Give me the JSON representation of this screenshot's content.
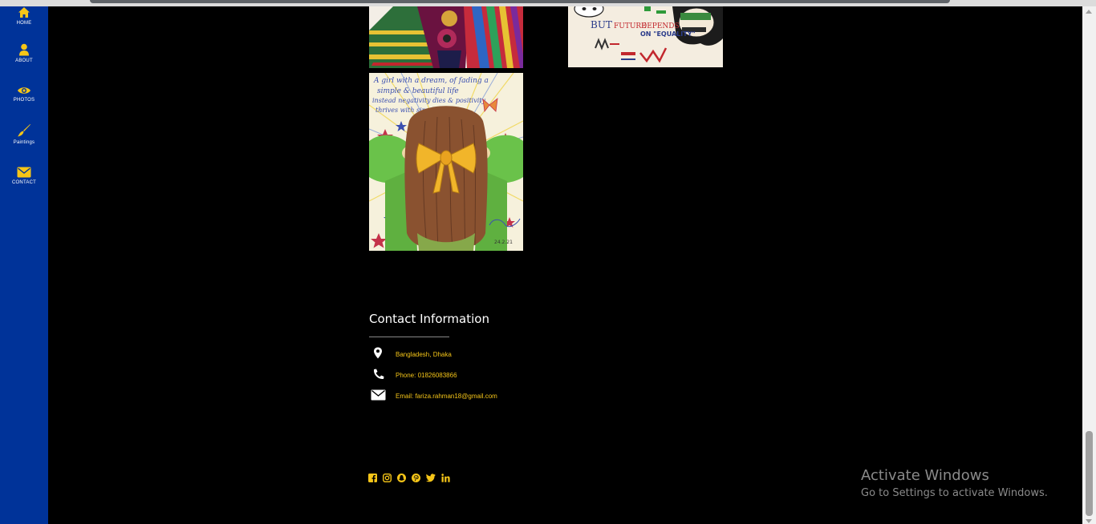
{
  "nav": {
    "items": [
      {
        "label": "HOME",
        "icon": "home-icon"
      },
      {
        "label": "ABOUT",
        "icon": "user-icon"
      },
      {
        "label": "PHOTOS",
        "icon": "eye-icon"
      },
      {
        "label": "Paintings",
        "icon": "paintbrush-icon"
      },
      {
        "label": "CONTACT",
        "icon": "envelope-icon"
      }
    ]
  },
  "gallery": {
    "poster_text": {
      "line1_a": "BUT",
      "line1_b": "FUTURE",
      "line1_c": "DEPENDS",
      "line2": "ON \"EQUALITY\""
    },
    "girl_painting_text": {
      "line1": "A girl with a dream, of fading a",
      "line2": "simple & beautiful life",
      "line3": "instead negativity dies & positivity",
      "line4": "thrives with simplicity",
      "signature": "24.2.21"
    }
  },
  "contact": {
    "title": "Contact Information",
    "address": "Bangladesh, Dhaka",
    "phone": "Phone: 01826083866",
    "email": "Email: fariza.rahman18@gmail.com"
  },
  "social": [
    "facebook-icon",
    "instagram-icon",
    "snapchat-icon",
    "pinterest-icon",
    "twitter-icon",
    "linkedin-icon"
  ],
  "windows_watermark": {
    "title": "Activate Windows",
    "subtitle": "Go to Settings to activate Windows."
  },
  "colors": {
    "sidebar": "#003399",
    "accent": "#f5c518",
    "background": "#000000"
  }
}
